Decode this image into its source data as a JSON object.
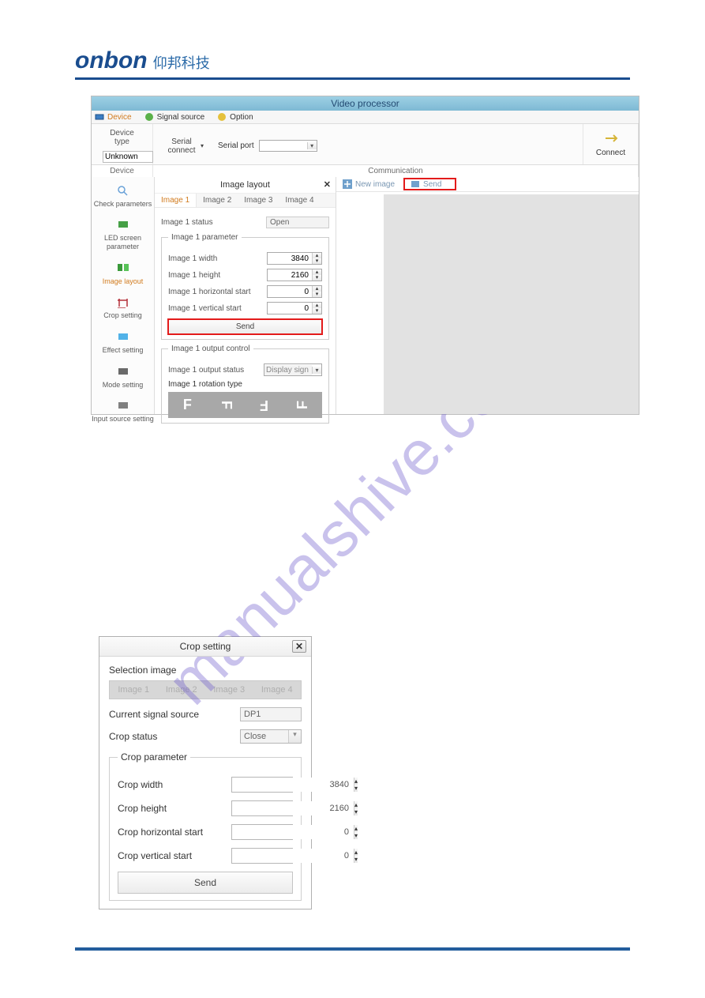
{
  "logo": {
    "brand": "onbon",
    "cn": "仰邦科技"
  },
  "watermark": "manualshive.com",
  "app1": {
    "title": "Video processor",
    "tabs": {
      "device": "Device",
      "signal": "Signal source",
      "option": "Option"
    },
    "ribbon": {
      "device_type_label": "Device type",
      "device_type_value": "Unknown",
      "device_group": "Device",
      "serial_connect": "Serial connect",
      "serial_port": "Serial port",
      "connect": "Connect",
      "comm_group": "Communication"
    },
    "sidebar": {
      "check": "Check parameters",
      "led": "LED screen parameter",
      "layout": "Image layout",
      "crop": "Crop setting",
      "effect": "Effect setting",
      "mode": "Mode setting",
      "input": "Input source setting"
    },
    "panel": {
      "title": "Image layout",
      "tabs": [
        "Image 1",
        "Image 2",
        "Image 3",
        "Image 4"
      ],
      "status_label": "Image 1 status",
      "status_value": "Open",
      "param_legend": "Image 1 parameter",
      "width_label": "Image 1 width",
      "width_value": "3840",
      "height_label": "Image 1 height",
      "height_value": "2160",
      "hstart_label": "Image 1 horizontal start",
      "hstart_value": "0",
      "vstart_label": "Image 1 vertical start",
      "vstart_value": "0",
      "send": "Send",
      "output_legend": "Image 1 output control",
      "output_status_label": "Image 1 output status",
      "output_status_value": "Display sign",
      "rotation_label": "Image 1 rotation type"
    },
    "toolbar": {
      "new_image": "New image",
      "send": "Send"
    }
  },
  "crop": {
    "title": "Crop setting",
    "selection_label": "Selection image",
    "sel_tabs": [
      "Image 1",
      "Image 2",
      "Image 3",
      "Image 4"
    ],
    "signal_label": "Current signal source",
    "signal_value": "DP1",
    "status_label": "Crop status",
    "status_value": "Close",
    "param_legend": "Crop parameter",
    "width_label": "Crop width",
    "width_value": "3840",
    "height_label": "Crop height",
    "height_value": "2160",
    "hstart_label": "Crop horizontal start",
    "hstart_value": "0",
    "vstart_label": "Crop vertical start",
    "vstart_value": "0",
    "send": "Send"
  }
}
